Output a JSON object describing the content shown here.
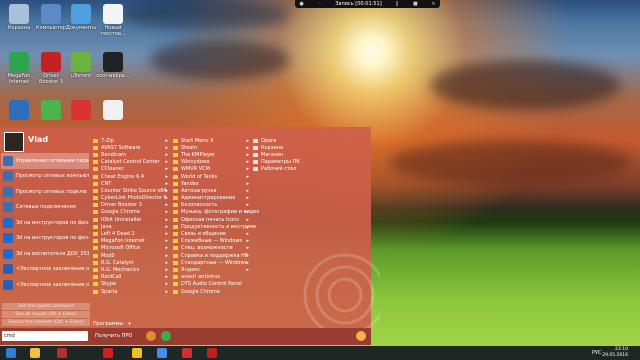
{
  "colors": {
    "menu_bg": "#ce604a",
    "accent_folder": "#f2c84b",
    "taskbar": "#141822"
  },
  "recorder": {
    "label": "Запись [00:01:51]"
  },
  "desktop": {
    "icons": [
      {
        "label": "Корзина",
        "icon": "recycle-bin-icon",
        "color": "#a8c0d8"
      },
      {
        "label": "Компьютер",
        "icon": "computer-icon",
        "color": "#5a8ac8"
      },
      {
        "label": "Документы",
        "icon": "documents-icon",
        "color": "#4ea0e0"
      },
      {
        "label": "Новый текстов...",
        "icon": "text-file-icon",
        "color": "#f4f4f4"
      },
      {
        "label": "MegaFon Internet",
        "icon": "megafon-icon",
        "color": "#2da44e"
      },
      {
        "label": "Driver Booster 3",
        "icon": "driver-booster-icon",
        "color": "#c32222"
      },
      {
        "label": "uTorrent",
        "icon": "utorrent-icon",
        "color": "#6db33f"
      },
      {
        "label": "cool-wallpa...",
        "icon": "image-file-icon",
        "color": "#222222"
      },
      {
        "label": "",
        "icon": "app-icon",
        "color": "#2a6fb8"
      },
      {
        "label": "",
        "icon": "game-icon",
        "color": "#4bb54b"
      },
      {
        "label": "",
        "icon": "record-icon",
        "color": "#d83232"
      },
      {
        "label": "",
        "icon": "app2-icon",
        "color": "#f0f0f0"
      }
    ]
  },
  "start_menu": {
    "user": {
      "name": "Vlad"
    },
    "left_items": [
      "Управление сетевыми парам",
      "Просмотр сетевых компьют",
      "Просмотр сетевых подклю",
      "Сетевые подключения",
      "3d на инструкторов по физ-р",
      "3d на инструкторов по физ-р",
      "3d на воспитателя ДОУ_201",
      "<Экспертное заключение н",
      "<Экспертное заключение н"
    ],
    "search_hints": [
      "Run the typed command",
      "See all results (Alt + Enter)",
      "Search the Internet (Ctrl + Enter)"
    ],
    "programs_label": "Программы",
    "plus": "+",
    "search_value": "cmd",
    "pro_label": "Получить ПРО",
    "col_programs": [
      {
        "label": "7-Zip",
        "arrow": true
      },
      {
        "label": "AVAST Software",
        "arrow": true
      },
      {
        "label": "Bandicam",
        "arrow": true
      },
      {
        "label": "Catalyst Control Center",
        "arrow": true
      },
      {
        "label": "CCleaner",
        "arrow": true
      },
      {
        "label": "Cheat Engine 6.4",
        "arrow": true
      },
      {
        "label": "CNT",
        "arrow": true
      },
      {
        "label": "Counter Strike Source v84",
        "arrow": true
      },
      {
        "label": "CyberLink PhotoDirector 6",
        "arrow": true
      },
      {
        "label": "Driver Booster 3",
        "arrow": true
      },
      {
        "label": "Google Chrome",
        "arrow": true
      },
      {
        "label": "IObit Uninstaller",
        "arrow": true
      },
      {
        "label": "Java",
        "arrow": true
      },
      {
        "label": "Left 4 Dead 2",
        "arrow": true
      },
      {
        "label": "MegaFon Internet",
        "arrow": true
      },
      {
        "label": "Microsoft Office",
        "arrow": true
      },
      {
        "label": "Mod0",
        "arrow": true
      },
      {
        "label": "R.G. Catalyst",
        "arrow": true
      },
      {
        "label": "R.G. Mechanics",
        "arrow": true
      },
      {
        "label": "RaidCall",
        "arrow": true
      },
      {
        "label": "Skype",
        "arrow": true
      },
      {
        "label": "Sparta",
        "arrow": true
      }
    ],
    "col_folders": [
      {
        "label": "Start Menu X",
        "arrow": true
      },
      {
        "label": "Steam",
        "arrow": true
      },
      {
        "label": "The KMPlayer",
        "arrow": true
      },
      {
        "label": "Winnydows",
        "arrow": true
      },
      {
        "label": "WMVR VCM",
        "arrow": true
      },
      {
        "label": "World of Tanks",
        "arrow": true
      },
      {
        "label": "Yandex",
        "arrow": true
      },
      {
        "label": "Автозагрузка",
        "arrow": true
      },
      {
        "label": "Администрирование",
        "arrow": true
      },
      {
        "label": "Безопасность",
        "arrow": true
      },
      {
        "label": "Музыка, фотографии и видео",
        "arrow": true
      },
      {
        "label": "Офисная печать Icons",
        "arrow": true
      },
      {
        "label": "Продуктивность и инструме",
        "arrow": true
      },
      {
        "label": "Связь и общение",
        "arrow": true
      },
      {
        "label": "Служебные — Windows",
        "arrow": true
      },
      {
        "label": "Спец. возможности",
        "arrow": true
      },
      {
        "label": "Справка и поддержка HP",
        "arrow": true
      },
      {
        "label": "Стандартные — Windows",
        "arrow": true
      },
      {
        "label": "Яндекс",
        "arrow": true
      },
      {
        "label": "avast! antivirus",
        "arrow": false
      },
      {
        "label": "DTS Audio Control Panel",
        "arrow": false
      },
      {
        "label": "Google Chrome",
        "arrow": false
      }
    ],
    "col_system": [
      {
        "label": "Opera",
        "arrow": false
      },
      {
        "label": "Корзина",
        "arrow": false
      },
      {
        "label": "Магазин",
        "arrow": false
      },
      {
        "label": "Параметры ПК",
        "arrow": false
      },
      {
        "label": "Рабочий стол",
        "arrow": false
      }
    ]
  },
  "taskbar": {
    "items": [
      "windows-start-icon",
      "file-explorer-icon",
      "winrar-icon",
      "opera-icon",
      "yandex-icon",
      "chrome-icon",
      "opera-browser-icon",
      "recorder-icon"
    ],
    "lang": "РУС",
    "time": "23:10",
    "date": "29.05.2016"
  }
}
